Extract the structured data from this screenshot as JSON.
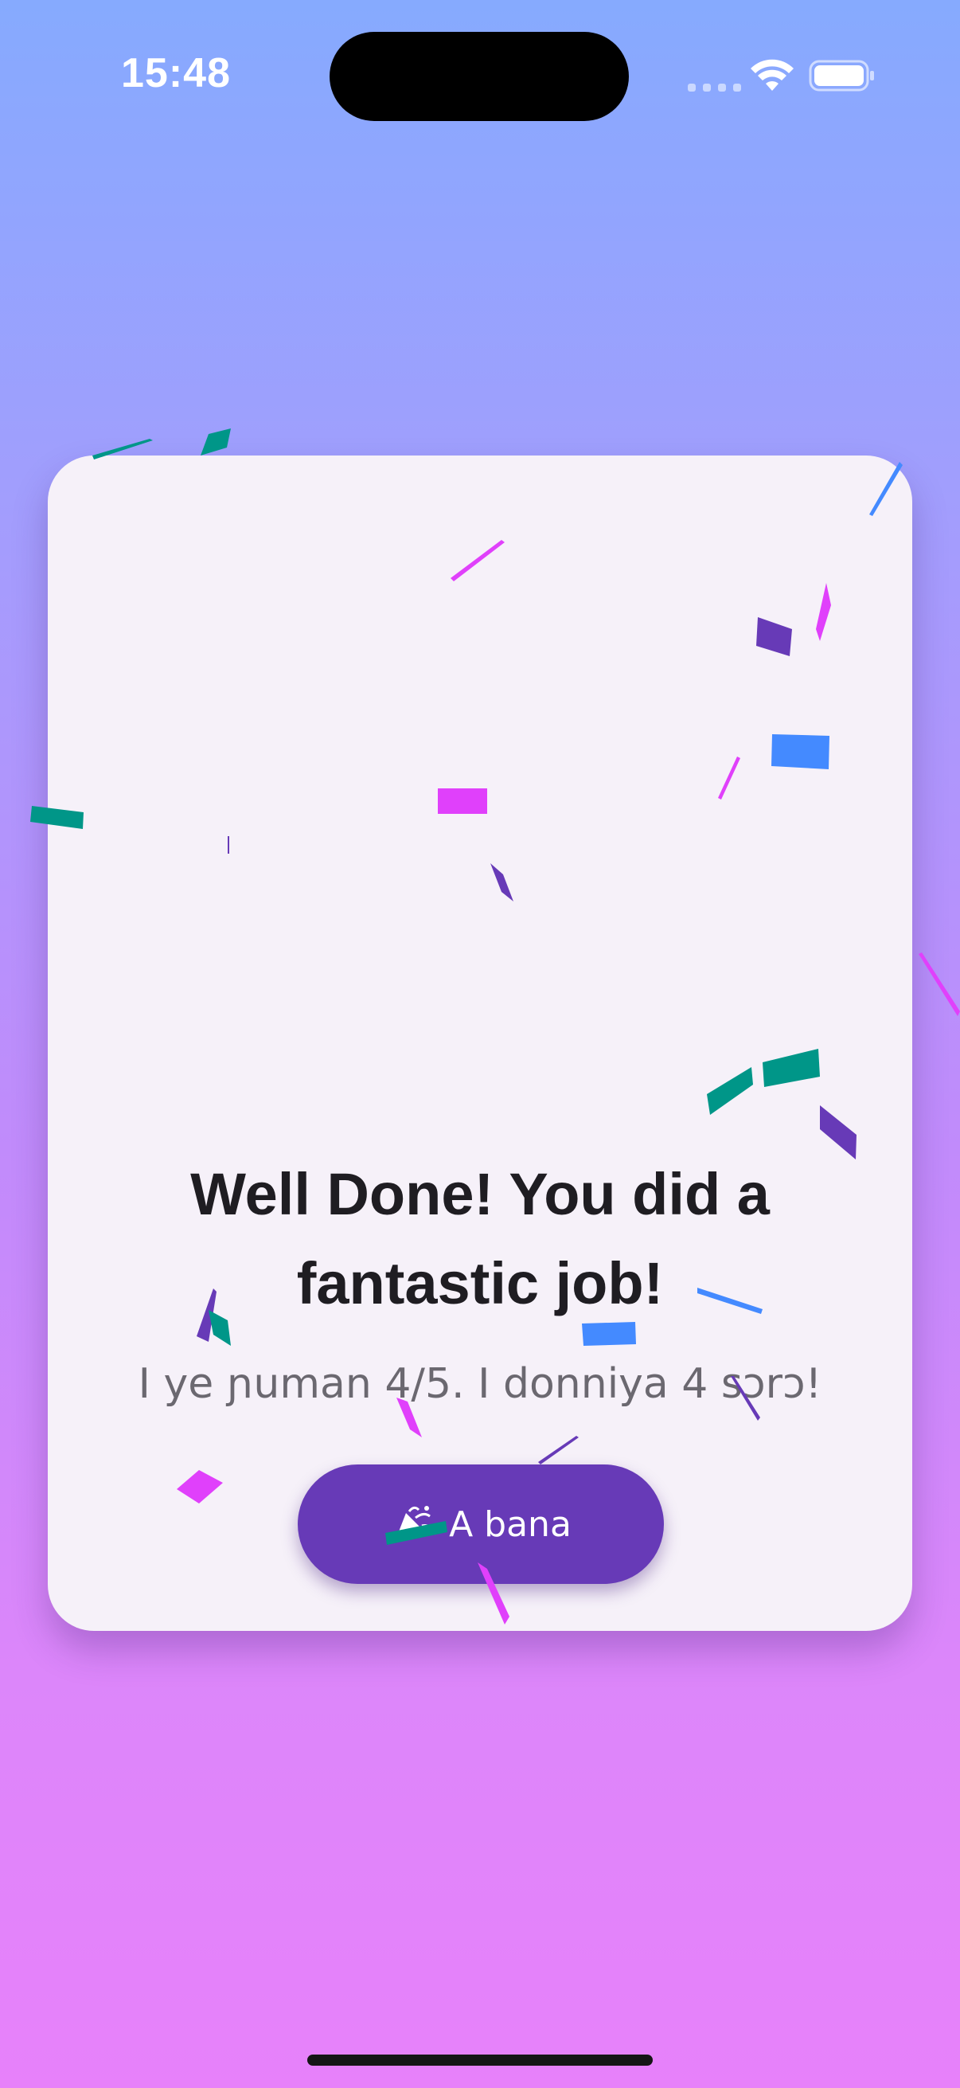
{
  "status_bar": {
    "time": "15:48",
    "icons": [
      "cellular-signal-icon",
      "wifi-icon",
      "battery-icon"
    ]
  },
  "result_card": {
    "title": "Well Done! You did a fantastic job!",
    "subtitle": "I ye ɲuman 4/5. I donniya 4 sɔrɔ!",
    "score": 4,
    "total": 5,
    "home_button": {
      "icon": "party-popper-icon",
      "label": "A bana"
    }
  },
  "confetti": {
    "colors": [
      "#009688",
      "#673ab7",
      "#e040fb",
      "#448aff"
    ]
  },
  "colors": {
    "background_top": "#86aafe",
    "background_bottom": "#e781fa",
    "card": "#f6f1f9",
    "button": "#673ab7",
    "title": "#1f1d22",
    "subtitle": "#6b6870"
  }
}
